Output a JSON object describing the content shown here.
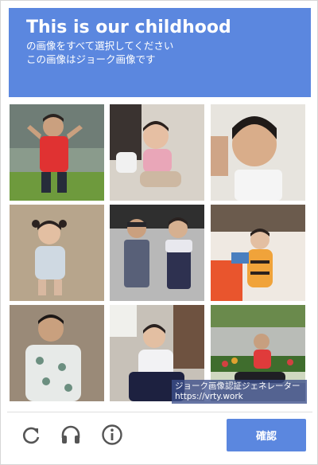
{
  "header": {
    "title": "This is our childhood",
    "instruction_line1": "の画像をすべて選択してください",
    "instruction_line2": "この画像はジョーク画像です"
  },
  "tiles": [
    {
      "name": "photo-boy-red-shirt"
    },
    {
      "name": "photo-baby-girl-sitting"
    },
    {
      "name": "photo-boy-closeup"
    },
    {
      "name": "photo-toddler-pigtails"
    },
    {
      "name": "photo-siblings-standing"
    },
    {
      "name": "photo-toddler-tiger-costume"
    },
    {
      "name": "photo-boy-yukata"
    },
    {
      "name": "photo-toddler-in-room"
    },
    {
      "name": "photo-boy-on-bike"
    }
  ],
  "watermark": {
    "line1": "ジョーク画像認証ジェネレーター",
    "line2": "https://vrty.work"
  },
  "footer": {
    "reload_icon": "reload-icon",
    "audio_icon": "headphones-icon",
    "info_icon": "info-icon",
    "verify_label": "確認"
  },
  "colors": {
    "accent": "#5b87df",
    "icon_gray": "#555555"
  }
}
